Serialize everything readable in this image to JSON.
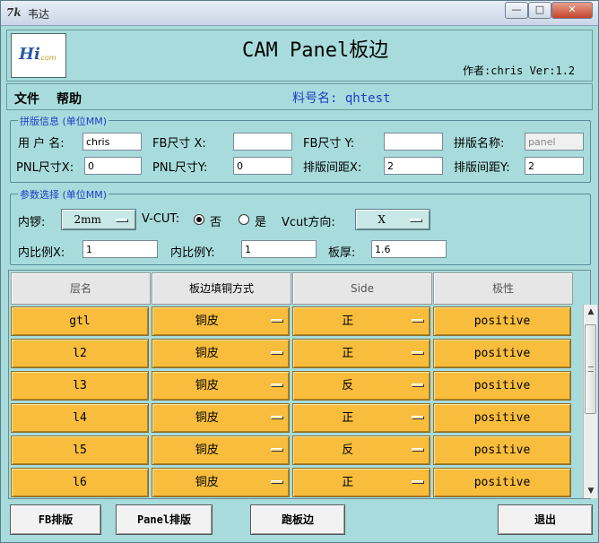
{
  "window": {
    "title": "韦达",
    "icon_glyph": "7k"
  },
  "titlebar_buttons": {
    "minimize": "—",
    "maximize": "□",
    "close": "✕"
  },
  "header": {
    "title": "CAM Panel板边",
    "author": "作者:chris  Ver:1.2",
    "logo": {
      "mark": "Hi",
      "sub": ".com"
    }
  },
  "menu": {
    "file": "文件",
    "help": "帮助"
  },
  "part_number": "料号名: qhtest",
  "layout_info": {
    "legend": "拼版信息 (单位MM)",
    "user_label": "用 户 名:",
    "user_value": "chris",
    "fb_x_label": "FB尺寸 X:",
    "fb_x_value": "",
    "fb_y_label": "FB尺寸 Y:",
    "fb_y_value": "",
    "panel_name_label": "拼版名称:",
    "panel_name_value": "panel",
    "pnl_x_label": "PNL尺寸X:",
    "pnl_x_value": "0",
    "pnl_y_label": "PNL尺寸Y:",
    "pnl_y_value": "0",
    "gap_x_label": "排版间距X:",
    "gap_x_value": "2",
    "gap_y_label": "排版间距Y:",
    "gap_y_value": "2"
  },
  "params": {
    "legend": "参数选择 (单位MM)",
    "inner_rivet_label": "内锣:",
    "inner_rivet_value": "2mm",
    "vcut_label": "V-CUT:",
    "vcut_no": "否",
    "vcut_yes": "是",
    "vcut_selected": "否",
    "vcut_dir_label": "Vcut方向:",
    "vcut_dir_value": "X",
    "ratio_x_label": "内比例X:",
    "ratio_x_value": "1",
    "ratio_y_label": "内比例Y:",
    "ratio_y_value": "1",
    "thickness_label": "板厚:",
    "thickness_value": "1.6"
  },
  "table": {
    "headers": [
      "层名",
      "板边填铜方式",
      "Side",
      "极性"
    ],
    "rows": [
      {
        "layer": "gtl",
        "fill": "铜皮",
        "side": "正",
        "polarity": "positive"
      },
      {
        "layer": "l2",
        "fill": "铜皮",
        "side": "正",
        "polarity": "positive"
      },
      {
        "layer": "l3",
        "fill": "铜皮",
        "side": "反",
        "polarity": "positive"
      },
      {
        "layer": "l4",
        "fill": "铜皮",
        "side": "正",
        "polarity": "positive"
      },
      {
        "layer": "l5",
        "fill": "铜皮",
        "side": "反",
        "polarity": "positive"
      },
      {
        "layer": "l6",
        "fill": "铜皮",
        "side": "正",
        "polarity": "positive"
      }
    ],
    "scroll_up": "▲",
    "scroll_down": "▼"
  },
  "buttons": {
    "fb_layout": "FB排版",
    "panel_layout": "Panel排版",
    "run_edge": "跑板边",
    "exit": "退出"
  }
}
